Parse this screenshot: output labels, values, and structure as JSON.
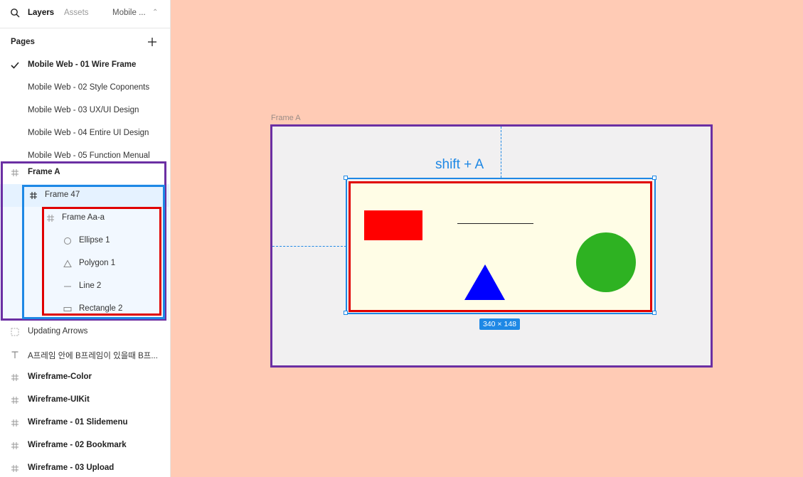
{
  "header": {
    "tab_layers": "Layers",
    "tab_assets": "Assets",
    "page_switcher": "Mobile ..."
  },
  "pages": {
    "title": "Pages",
    "items": [
      "Mobile Web - 01 Wire Frame",
      "Mobile Web - 02 Style Coponents",
      "Mobile Web - 03 UX/UI Design",
      "Mobile Web - 04 Entire UI Design",
      "Mobile Web - 05 Function Menual"
    ]
  },
  "layers": {
    "items": [
      {
        "label": "Frame A",
        "icon": "frame-icon"
      },
      {
        "label": "Frame 47",
        "icon": "frame-icon"
      },
      {
        "label": "Frame Aa-a",
        "icon": "frame-icon"
      },
      {
        "label": "Ellipse 1",
        "icon": "ellipse-icon"
      },
      {
        "label": "Polygon 1",
        "icon": "polygon-icon"
      },
      {
        "label": "Line 2",
        "icon": "line-icon"
      },
      {
        "label": "Rectangle 2",
        "icon": "rectangle-icon"
      },
      {
        "label": "Updating Arrows",
        "icon": "section-icon"
      },
      {
        "label": "A프레임 안에 B프레임이 있을때 B프...",
        "icon": "text-icon"
      },
      {
        "label": "Wireframe-Color",
        "icon": "frame-icon"
      },
      {
        "label": "Wireframe-UIKit",
        "icon": "frame-icon"
      },
      {
        "label": "Wireframe - 01 Slidemenu",
        "icon": "frame-icon"
      },
      {
        "label": "Wireframe - 02 Bookmark",
        "icon": "frame-icon"
      },
      {
        "label": "Wireframe - 03 Upload",
        "icon": "frame-icon"
      }
    ]
  },
  "canvas": {
    "frame_label": "Frame A",
    "shortcut_text": "shift + A",
    "size_badge": "340 × 148"
  },
  "colors": {
    "canvas_bg": "#ffcbb5",
    "purple_outline": "#6b2fa3",
    "blue_outline": "#1e88e5",
    "red_outline": "#e00000",
    "rectangle_fill": "#ff0000",
    "ellipse_fill": "#2eb222",
    "triangle_fill": "#0000ff"
  }
}
